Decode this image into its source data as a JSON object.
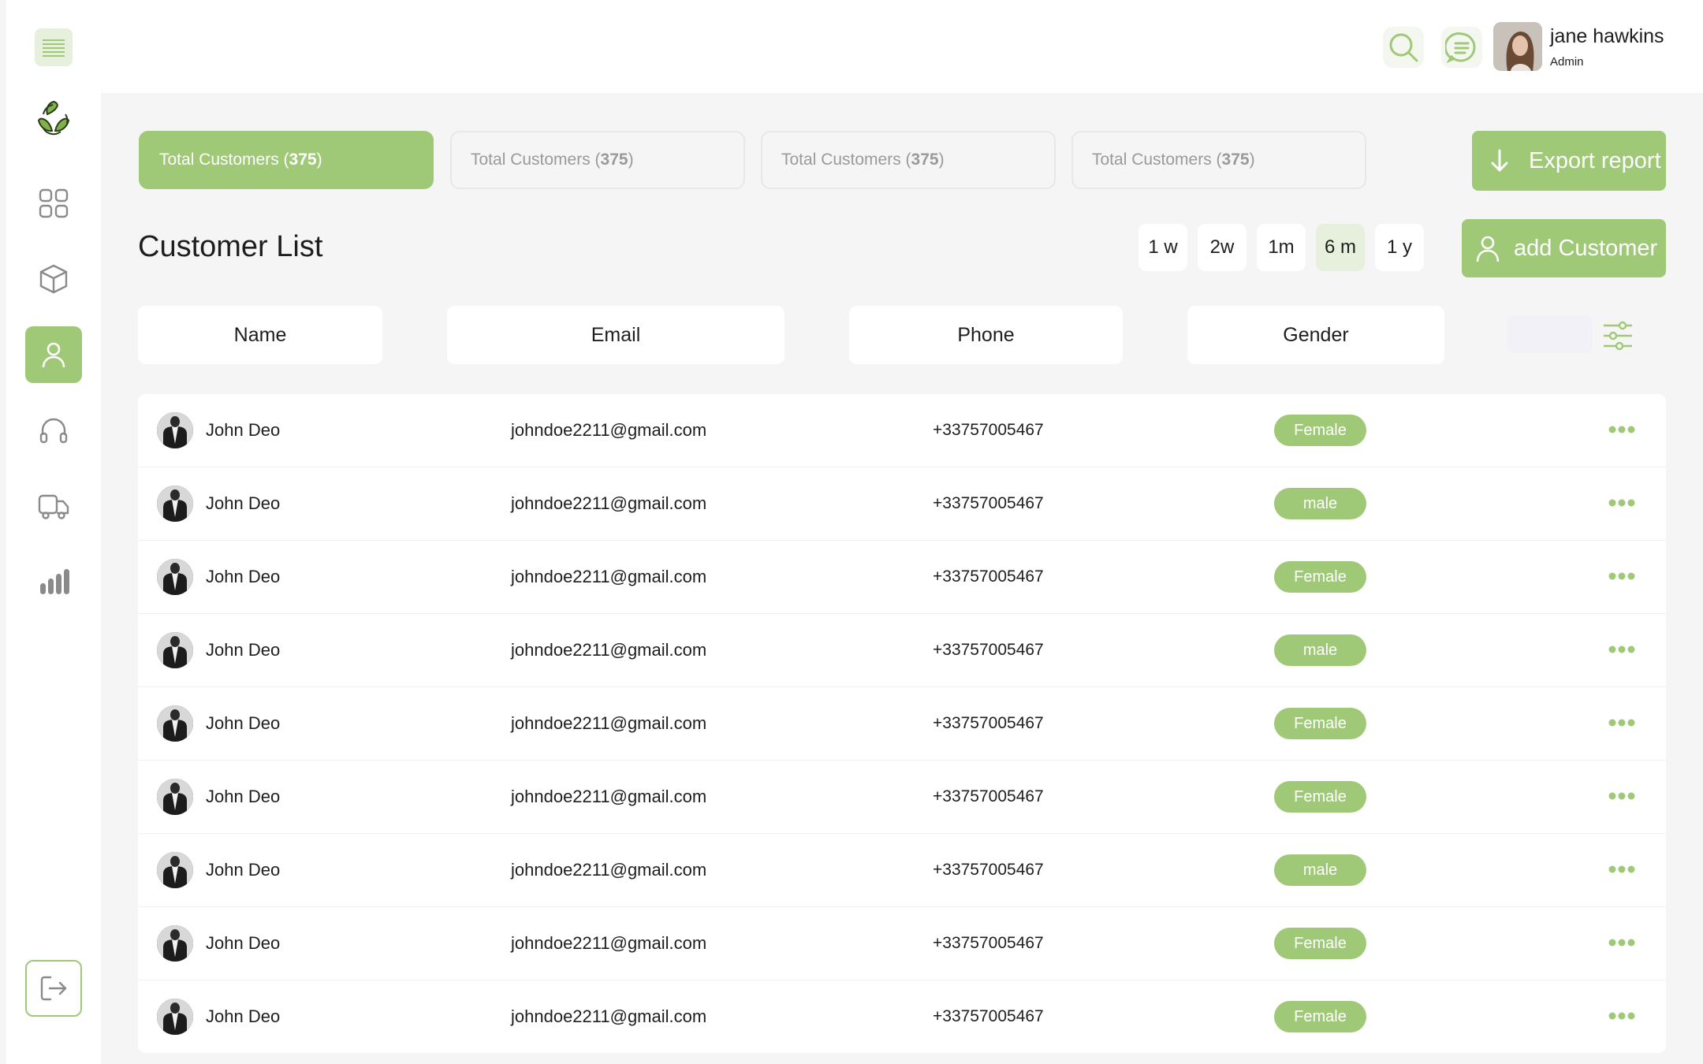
{
  "colors": {
    "accent": "#9fc977",
    "accent_light": "#e7f0dd",
    "background": "#f5f5f5",
    "surface": "#ffffff",
    "text": "#1e1e1e",
    "muted": "#9a9a9a"
  },
  "sidebar": {
    "items": [
      {
        "icon": "menu-icon"
      },
      {
        "icon": "recycle-logo-icon"
      },
      {
        "icon": "dashboard-grid-icon"
      },
      {
        "icon": "box-icon"
      },
      {
        "icon": "user-icon",
        "active": true
      },
      {
        "icon": "headphones-icon"
      },
      {
        "icon": "truck-icon"
      },
      {
        "icon": "bar-chart-icon"
      },
      {
        "icon": "logout-icon"
      }
    ]
  },
  "header": {
    "icons": [
      "search-icon",
      "message-icon",
      "bell-icon"
    ],
    "user": {
      "name": "jane hawkins",
      "role": "Admin"
    }
  },
  "summary_cards": [
    {
      "label": "Total Customers (",
      "count": "375",
      "suffix": ")",
      "active": true
    },
    {
      "label": "Total Customers (",
      "count": "375",
      "suffix": ")",
      "active": false
    },
    {
      "label": "Total Customers (",
      "count": "375",
      "suffix": ")",
      "active": false
    },
    {
      "label": "Total Customers (",
      "count": "375",
      "suffix": ")",
      "active": false
    }
  ],
  "export_button": {
    "label": "Export report"
  },
  "list": {
    "title": "Customer List",
    "periods": [
      "1 w",
      "2w",
      "1m",
      "6 m",
      "1 y"
    ],
    "active_period": "6 m",
    "add_button": "add Customer",
    "columns": [
      "Name",
      "Email",
      "Phone",
      "Gender"
    ]
  },
  "rows": [
    {
      "name": "John Deo",
      "email": "johndoe2211@gmail.com",
      "phone": "+33757005467",
      "gender": "Female"
    },
    {
      "name": "John Deo",
      "email": "johndoe2211@gmail.com",
      "phone": "+33757005467",
      "gender": "male"
    },
    {
      "name": "John Deo",
      "email": "johndoe2211@gmail.com",
      "phone": "+33757005467",
      "gender": "Female"
    },
    {
      "name": "John Deo",
      "email": "johndoe2211@gmail.com",
      "phone": "+33757005467",
      "gender": "male"
    },
    {
      "name": "John Deo",
      "email": "johndoe2211@gmail.com",
      "phone": "+33757005467",
      "gender": "Female"
    },
    {
      "name": "John Deo",
      "email": "johndoe2211@gmail.com",
      "phone": "+33757005467",
      "gender": "Female"
    },
    {
      "name": "John Deo",
      "email": "johndoe2211@gmail.com",
      "phone": "+33757005467",
      "gender": "male"
    },
    {
      "name": "John Deo",
      "email": "johndoe2211@gmail.com",
      "phone": "+33757005467",
      "gender": "Female"
    },
    {
      "name": "John Deo",
      "email": "johndoe2211@gmail.com",
      "phone": "+33757005467",
      "gender": "Female"
    }
  ]
}
